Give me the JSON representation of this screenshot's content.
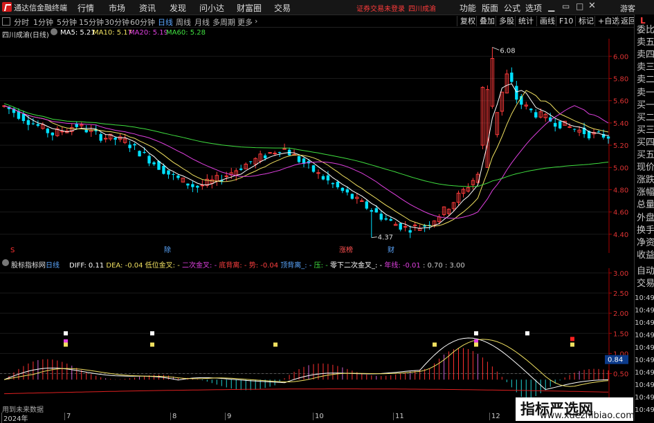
{
  "app": {
    "title": "通达信金融终端"
  },
  "menu": [
    "行情",
    "市场",
    "资讯",
    "发现",
    "问小达",
    "财富圈",
    "交易"
  ],
  "login_warning": "证券交易未登录",
  "stock_name": "四川成渝",
  "right_menu": [
    "功能",
    "版面",
    "公式",
    "选项"
  ],
  "guest_label": "游客",
  "periods": [
    "分时",
    "1分钟",
    "5分钟",
    "15分钟",
    "30分钟",
    "60分钟",
    "日线",
    "周线",
    "月线",
    "多周期",
    "更多"
  ],
  "active_period": "日线",
  "tools": [
    "复权",
    "叠加",
    "多股",
    "统计",
    "画线",
    "F10",
    "标记",
    "+自选",
    "返回"
  ],
  "main_title": "四川成渝(日线)",
  "ma": [
    {
      "label": "MA5: 5.21",
      "color": "#ffffff"
    },
    {
      "label": "MA10: 5.17",
      "color": "#f0e060"
    },
    {
      "label": "MA20: 5.19",
      "color": "#e040e0"
    },
    {
      "label": "MA60: 5.28",
      "color": "#40e040"
    }
  ],
  "price_axis": [
    "6.00",
    "5.80",
    "5.60",
    "5.40",
    "5.20",
    "5.00",
    "4.80",
    "4.60",
    "4.40"
  ],
  "annotations": {
    "high": "6.08",
    "low": "4.37"
  },
  "event_labels": [
    {
      "text": "S",
      "color": "#ff3030"
    },
    {
      "text": "除",
      "color": "#5ba7ff"
    },
    {
      "text": "涨榜",
      "color": "#ff5050"
    },
    {
      "text": "财",
      "color": "#5ba7ff"
    }
  ],
  "indicator": {
    "name": "股标指标网",
    "period_tag": "日线",
    "items": [
      {
        "text": "DIFF: 0.11",
        "color": "#ffffff"
      },
      {
        "text": "DEA: -0.04",
        "color": "#f0e060"
      },
      {
        "text": "低位金叉: -",
        "color": "#f0e060"
      },
      {
        "text": "二次金叉: -",
        "color": "#e040e0"
      },
      {
        "text": "底背离: -",
        "color": "#ff4040"
      },
      {
        "text": "势: -0.04",
        "color": "#ff4040"
      },
      {
        "text": "顶背离_: -",
        "color": "#5ba7ff"
      },
      {
        "text": "压: -",
        "color": "#40e040"
      },
      {
        "text": "零下二次金叉_: -",
        "color": "#ffffff"
      },
      {
        "text": "年线: -0.01",
        "color": "#e040e0"
      },
      {
        "text": ": 0.70 : 3.00",
        "color": "#cccccc"
      }
    ],
    "axis": [
      "3.00",
      "2.50",
      "2.00",
      "1.50",
      "1.00",
      "0.50"
    ],
    "current_value": "0.84",
    "future_data_note": "用到未来数据"
  },
  "date_axis": [
    "2024年",
    "7",
    "8",
    "9",
    "10",
    "11",
    "12"
  ],
  "right_panel": {
    "labels": [
      "委比",
      "卖五",
      "卖四",
      "卖三",
      "卖二",
      "卖一",
      "买一",
      "买二",
      "买三",
      "买四",
      "买五",
      "现价",
      "涨跌",
      "涨幅",
      "总量",
      "外盘",
      "换手",
      "净资",
      "收益"
    ],
    "lower_labels": [
      "自动",
      "交易"
    ],
    "times": [
      "10:49",
      "10:49",
      "10:49",
      "10:49",
      "10:49",
      "10:49",
      "10:49",
      "10:49",
      "10:49",
      "10:49"
    ],
    "badge": "L"
  },
  "watermark": {
    "title": "指标严选网",
    "url": "www.xuezhibiao.com"
  },
  "colors": {
    "up": "#ff3b3b",
    "down": "#00e0ff",
    "ma5": "#ffffff",
    "ma10": "#f0e060",
    "ma20": "#e040e0",
    "ma60": "#40e040",
    "macd_pos": "#ff3030",
    "macd_neg": "#20d0d0"
  }
}
